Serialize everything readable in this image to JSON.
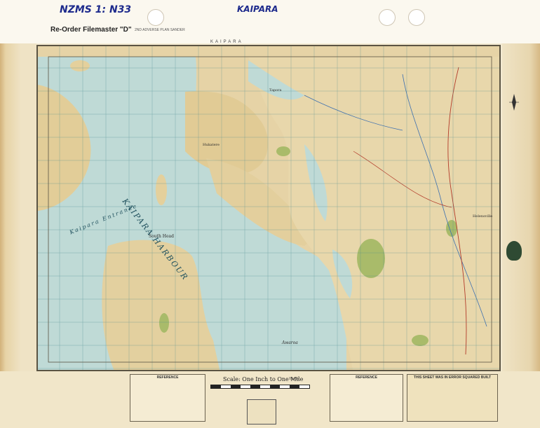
{
  "handwritten": {
    "sheet_code": "NZMS 1: N33",
    "sheet_name": "KAIPARA"
  },
  "header": {
    "reorder_label": "Re-Order Filemaster \"D\"",
    "series_label": "2ND ADVERSE PLAN SANDER"
  },
  "map_title_strip": "KAIPARA",
  "map": {
    "place_labels": {
      "kaipara_harbour": "KAIPARA HARBOUR",
      "kaipara_entrance": "Kaipara Entrance",
      "south_head": "South Head",
      "helensville": "Helensville",
      "awaroa": "Awaroa",
      "hukatere": "Hukatere",
      "tapora": "Tapora"
    },
    "land_color": "#e7d7ad",
    "water_color": "#bcd9d7",
    "grid_color": "#4a8a8f"
  },
  "legend_left": {
    "title": "REFERENCE"
  },
  "scale": {
    "title": "Scale: One Inch to One Mile",
    "sub": "Yards"
  },
  "legend_right": {
    "title": "REFERENCE"
  },
  "info_box": {
    "title": "THIS SHEET WAS IN ERROR SQUARED BUILT"
  }
}
